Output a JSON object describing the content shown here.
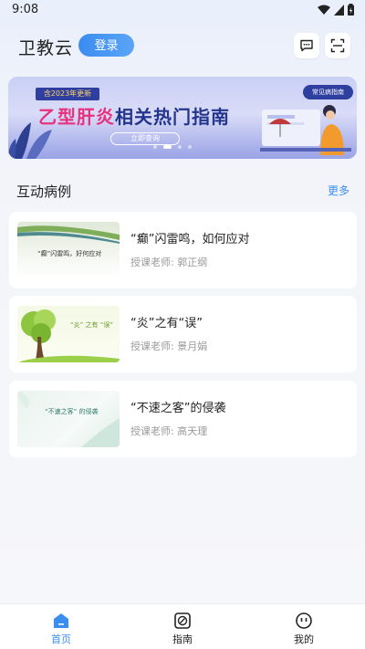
{
  "status": {
    "time": "9:08"
  },
  "header": {
    "title": "卫教云",
    "login_label": "登录"
  },
  "banner": {
    "tag": "含2023年更新",
    "title_part1": "乙型肝炎",
    "title_part2": "相关热门指南",
    "button": "立即查询",
    "label": "常见病指南",
    "pages": 4,
    "active_page": 2
  },
  "section": {
    "title": "互动病例",
    "more": "更多",
    "items": [
      {
        "title": "“癫”闪雷鸣，如何应对",
        "teacher": "授课老师: 郭正纲",
        "thumb_text": "“癫”闪雷鸣，好何应对"
      },
      {
        "title": "“炎”之有“误”",
        "teacher": "授课老师: 景月娟",
        "thumb_text": "“炎” 之有 “误”"
      },
      {
        "title": "“不速之客”的侵袭",
        "teacher": "授课老师: 高天理",
        "thumb_text": "“不速之客” 的侵袭"
      }
    ]
  },
  "tabs": [
    {
      "label": "首页",
      "icon": "home-icon",
      "active": true
    },
    {
      "label": "指南",
      "icon": "guide-icon",
      "active": false
    },
    {
      "label": "我的",
      "icon": "profile-icon",
      "active": false
    }
  ],
  "colors": {
    "accent": "#3a8ef0",
    "banner_pink": "#e8317e",
    "banner_navy": "#24358e"
  }
}
